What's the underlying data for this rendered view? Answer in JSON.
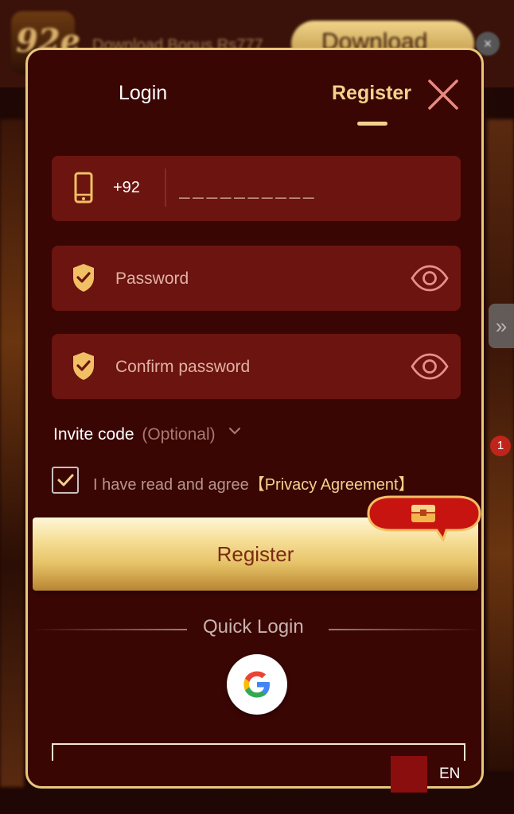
{
  "background": {
    "logo_text": "92e",
    "promo_text": "Download Bonus Rs777",
    "download_label": "Download",
    "close_glyph": "×",
    "notification_count": "1",
    "side_arrow_glyph": "»"
  },
  "modal": {
    "tabs": [
      {
        "label": "Login",
        "active": false
      },
      {
        "label": "Register",
        "active": true
      }
    ],
    "phone": {
      "icon": "phone-icon",
      "country_code": "+92",
      "placeholder": "__________"
    },
    "password": {
      "icon": "shield-check-icon",
      "placeholder": "Password",
      "visibility_icon": "eye-icon"
    },
    "confirm_password": {
      "icon": "shield-check-icon",
      "placeholder": "Confirm password",
      "visibility_icon": "eye-icon"
    },
    "invite": {
      "label": "Invite code",
      "optional": "(Optional)"
    },
    "agreement": {
      "checked": true,
      "text": "I have read and agree",
      "link": "【Privacy Agreement】"
    },
    "register_button": "Register",
    "quick_login_label": "Quick Login",
    "quick_login_providers": [
      "google-icon"
    ],
    "language": "EN"
  },
  "colors": {
    "modal_bg": "#3a0604",
    "field_bg": "#6b1410",
    "accent_gold": "#f2d28c",
    "border_gold": "#e8c87a",
    "close_x": "#e88a80"
  }
}
